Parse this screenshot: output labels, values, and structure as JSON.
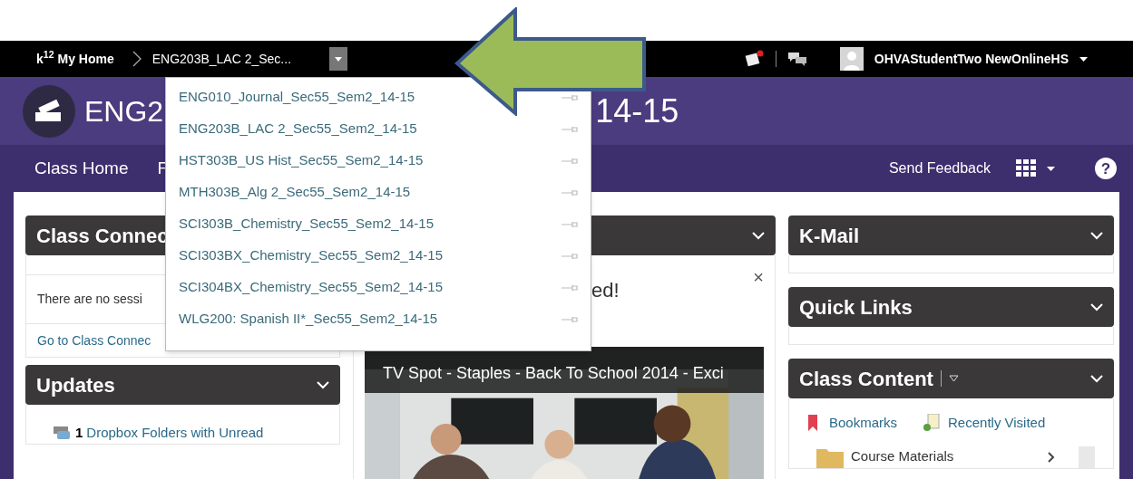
{
  "top_bar": {
    "logo": "k$^{12}$",
    "home": "My Home",
    "current_course": "ENG203B_LAC 2_Sec...",
    "user": "OHVAStudentTwo NewOnlineHS"
  },
  "course_menu": {
    "items": [
      {
        "label": "ENG010_Journal_Sec55_Sem2_14-15"
      },
      {
        "label": "ENG203B_LAC 2_Sec55_Sem2_14-15"
      },
      {
        "label": "HST303B_US Hist_Sec55_Sem2_14-15"
      },
      {
        "label": "MTH303B_Alg 2_Sec55_Sem2_14-15"
      },
      {
        "label": "SCI303B_Chemistry_Sec55_Sem2_14-15"
      },
      {
        "label": "SCI303BX_Chemistry_Sec55_Sem2_14-15"
      },
      {
        "label": "SCI304BX_Chemistry_Sec55_Sem2_14-15"
      },
      {
        "label": "WLG200: Spanish II*_Sec55_Sem2_14-15"
      }
    ]
  },
  "header": {
    "title_start": "ENG2",
    "title_end": "14-15"
  },
  "nav": {
    "items": [
      "Class Home",
      "F"
    ],
    "send_feedback": "Send Feedback",
    "help": "?"
  },
  "class_connect": {
    "title": "Class Connec",
    "message": "There are no sessi",
    "link": "Go to Class Connec"
  },
  "updates": {
    "title": "Updates",
    "items": [
      {
        "count": "1",
        "label": "Dropbox Folders with Unread"
      }
    ]
  },
  "center_panel": {
    "notice": "ed!",
    "close": "×",
    "video_title": "TV Spot - Staples - Back To School 2014 - Exci"
  },
  "kmail": {
    "title": "K-Mail"
  },
  "quick_links": {
    "title": "Quick Links"
  },
  "class_content": {
    "title": "Class Content",
    "links": [
      "Bookmarks",
      "Recently Visited"
    ],
    "items": [
      "Course Materials"
    ]
  }
}
